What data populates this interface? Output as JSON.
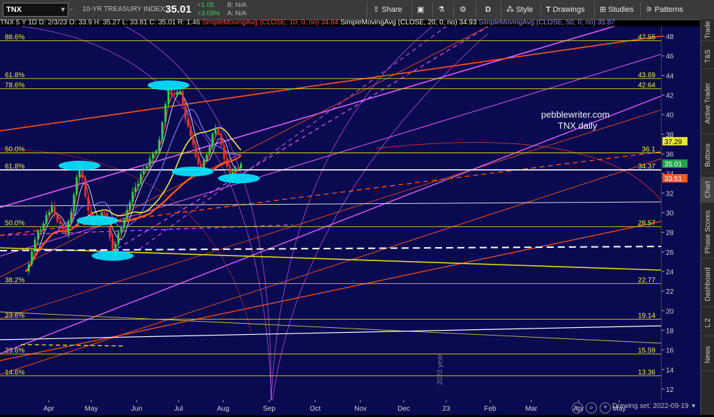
{
  "toolbar": {
    "symbol": "TNX",
    "description": "10-YR TREASURY INDEX",
    "last": "35.01",
    "change": "+1.05",
    "change_pct": "+3.09%",
    "bid": "B: N/A",
    "ask": "A: N/A",
    "share": "Share",
    "period": "D",
    "style": "Style",
    "drawings": "Drawings",
    "studies": "Studies",
    "patterns": "Patterns"
  },
  "studies": {
    "ohlc": "TNX 5 Y 1D  D: 2/3/23  O: 33.9  H: 35.27  L: 33.81  C: 35.01  R: 1.46",
    "sma10": "SimpleMovingAvg (CLOSE, 10, 0, no)  34.84",
    "sma20": "SimpleMovingAvg (CLOSE, 20, 0, no)  34.93",
    "sma50": "SimpleMovingAvg (CLOSE, 50, 0, no)  35.87"
  },
  "colors": {
    "plot_bg": "#0a0a50",
    "sma10": "#ff3b3b",
    "sma20": "#ffffff",
    "sma50": "#7a7aff",
    "fib_line": "#e0e000",
    "trend_magenta": "#e060ff",
    "trend_orange": "#ff5a1e",
    "highlight": "#00e5ff",
    "last_badge": "#1fa64a",
    "level_badge": "#ff5a1e",
    "sma_badge": "#e8e83a"
  },
  "sidebar": {
    "tabs": [
      "Trade",
      "T&S",
      "Active Trader",
      "Buttons",
      "Chart",
      "Phase Scores",
      "Dashboard",
      "L 2",
      "News"
    ],
    "active": "Chart"
  },
  "footer": {
    "drawing_set": "Drawing set: 2022-09-19"
  },
  "annotation": {
    "line1": "pebblewriter.com",
    "line2": "TNX daily",
    "year_marker": "2023 year"
  },
  "chart_data": {
    "type": "candlestick",
    "symbol": "TNX",
    "timeframe": "1D",
    "ylim": [
      11,
      49
    ],
    "y_ticks": [
      12,
      14,
      16,
      18,
      20,
      22,
      24,
      26,
      28,
      30,
      32,
      34,
      36,
      38,
      40,
      42,
      44,
      46,
      48
    ],
    "x_ticks": [
      "Apr",
      "May",
      "Jun",
      "Jul",
      "Aug",
      "Sep",
      "Oct",
      "Nov",
      "Dec",
      "23",
      "Feb",
      "Mar",
      "Apr",
      "May"
    ],
    "fib_levels": [
      {
        "label": "88.6%",
        "value": 47.55
      },
      {
        "label": "61.8%",
        "value": 43.69
      },
      {
        "label": "78.6%",
        "value": 42.64
      },
      {
        "label": "50.0%",
        "value": 36.1
      },
      {
        "label": "61.8%",
        "value": 34.37
      },
      {
        "label": "50.0%",
        "value": 28.57
      },
      {
        "label": "38.2%",
        "value": 22.77
      },
      {
        "label": "23.6%",
        "value": 19.14
      },
      {
        "label": "23.6%",
        "value": 15.59
      },
      {
        "label": "14.6%",
        "value": 13.36
      }
    ],
    "right_labels": [
      "47.55",
      "43.69",
      "42.64",
      "36.1",
      "34.37",
      "28.57",
      "22.77",
      "19.14",
      "15.59",
      "13.36"
    ],
    "price_badges": [
      {
        "label": "37.29",
        "value": 37.29,
        "color": "#e8e83a"
      },
      {
        "label": "35.01",
        "value": 35.01,
        "color": "#1fa64a"
      },
      {
        "label": "33.51",
        "value": 33.51,
        "color": "#ff5a1e"
      }
    ],
    "closes_approx": [
      {
        "date": "2022-03-28",
        "close": 24.0
      },
      {
        "date": "2022-04-15",
        "close": 28.0
      },
      {
        "date": "2022-05-05",
        "close": 30.5
      },
      {
        "date": "2022-05-25",
        "close": 27.5
      },
      {
        "date": "2022-06-14",
        "close": 34.8
      },
      {
        "date": "2022-07-01",
        "close": 28.9
      },
      {
        "date": "2022-07-20",
        "close": 30.2
      },
      {
        "date": "2022-08-01",
        "close": 25.8
      },
      {
        "date": "2022-08-22",
        "close": 30.5
      },
      {
        "date": "2022-09-15",
        "close": 34.6
      },
      {
        "date": "2022-10-03",
        "close": 36.2
      },
      {
        "date": "2022-10-21",
        "close": 42.3
      },
      {
        "date": "2022-11-07",
        "close": 42.1
      },
      {
        "date": "2022-11-22",
        "close": 37.6
      },
      {
        "date": "2022-12-07",
        "close": 34.2
      },
      {
        "date": "2022-12-28",
        "close": 38.8
      },
      {
        "date": "2023-01-18",
        "close": 33.7
      },
      {
        "date": "2023-02-03",
        "close": 35.01
      }
    ]
  }
}
